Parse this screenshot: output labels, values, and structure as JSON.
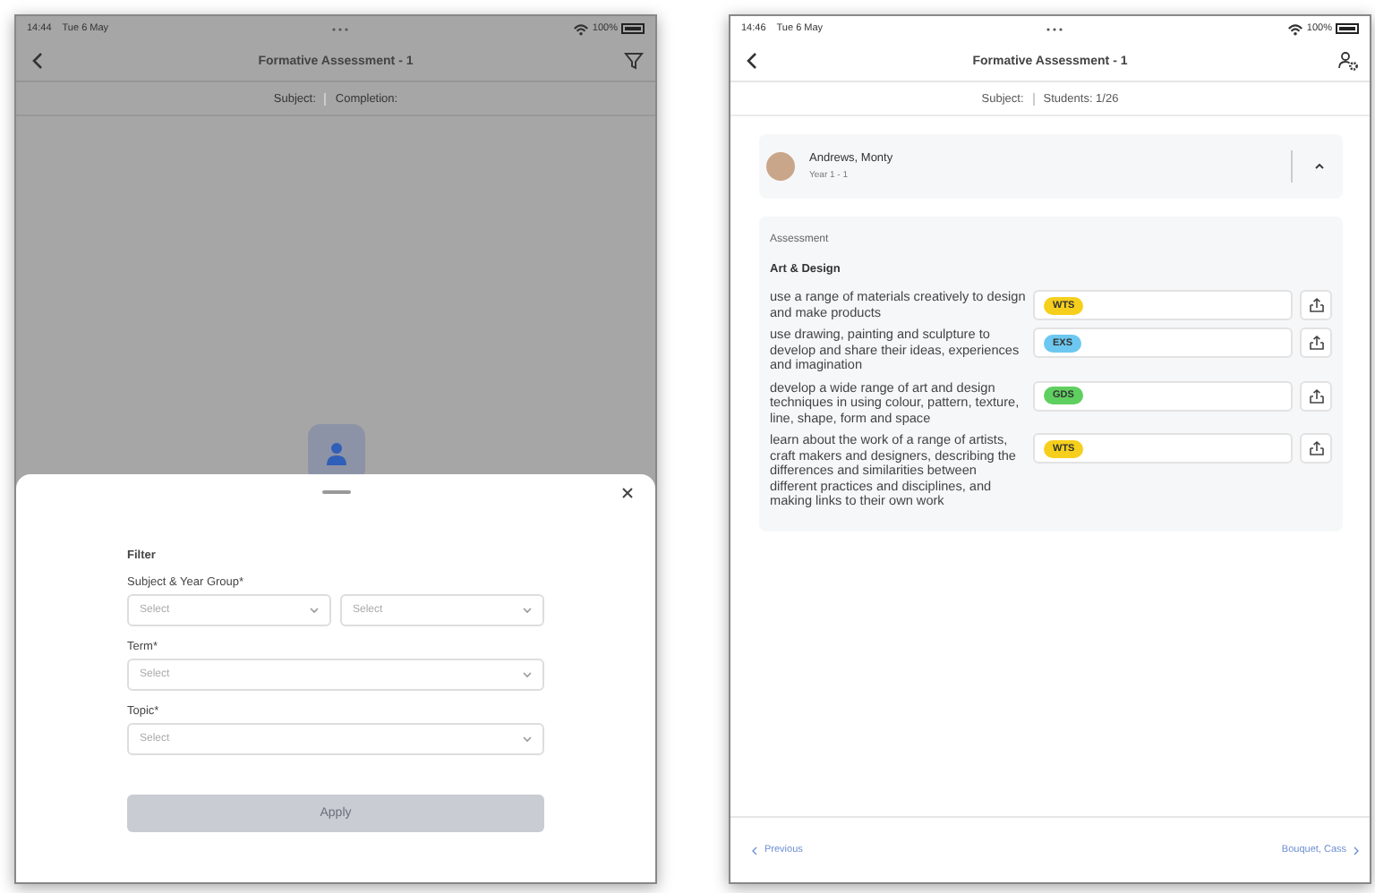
{
  "filter_screen": {
    "status_bar": {
      "time": "14:44",
      "date": "Tue 6 May",
      "battery": "100%"
    },
    "title": "Formative Assessment  - 1",
    "summary": [
      "Subject:",
      "Completion:"
    ],
    "sheet": {
      "heading": "Filter",
      "groups": [
        {
          "label": "Subject & Year Group*",
          "selects": [
            {
              "placeholder": "Select"
            },
            {
              "placeholder": "Select"
            }
          ]
        },
        {
          "label": "Term*",
          "selects": [
            {
              "placeholder": "Select"
            }
          ]
        },
        {
          "label": "Topic*",
          "selects": [
            {
              "placeholder": "Select"
            }
          ]
        }
      ],
      "apply": {
        "label": "Apply",
        "disabled": true
      }
    }
  },
  "assessment_screen": {
    "status_bar": {
      "time": "14:46",
      "date": "Tue 6 May",
      "battery": "100%"
    },
    "title": "Formative Assessment  - 1",
    "summary": [
      "Subject:",
      "Students: 1/26"
    ],
    "student": {
      "name": "Andrews, Monty",
      "group": "Year 1 - 1",
      "expanded": true
    },
    "section_label": "Assessment",
    "subject": "Art & Design",
    "criteria": [
      {
        "text": "use a range of materials creatively to design and make products",
        "grade": "WTS",
        "color": "#f5cf1c"
      },
      {
        "text": "use drawing, painting and sculpture to develop and share their ideas, experiences and imagination",
        "grade": "EXS",
        "color": "#6cc8f0"
      },
      {
        "text": "develop a wide range of art and design techniques in using colour, pattern, texture, line, shape, form and space",
        "grade": "GDS",
        "color": "#5fcf5f"
      },
      {
        "text": "learn about the work of a range of artists, craft makers and designers, describing the differences and similarities between different practices and disciplines, and making links to their own work",
        "grade": "WTS",
        "color": "#f5cf1c"
      }
    ],
    "footer": {
      "previous": "Previous",
      "next": "Bouquet, Cass"
    }
  }
}
